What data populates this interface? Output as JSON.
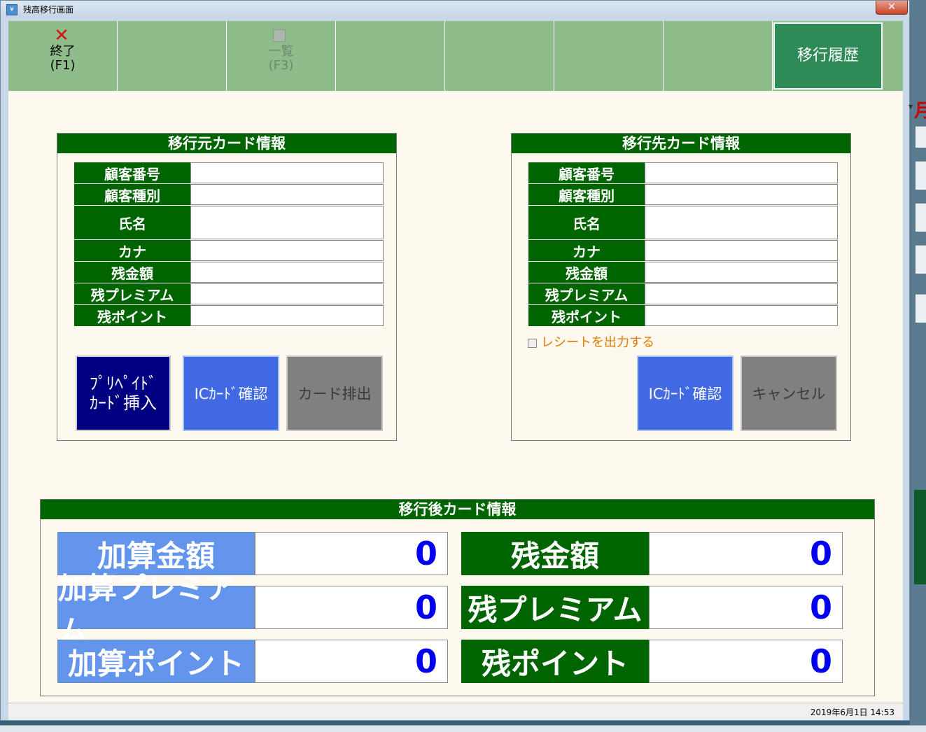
{
  "window": {
    "title": "残高移行画面",
    "close_label": "✕"
  },
  "toolbar": {
    "exit": {
      "label1": "終了",
      "label2": "(F1)"
    },
    "list": {
      "label1": "一覧",
      "label2": "(F3)"
    },
    "history_label": "移行履歴"
  },
  "source_card": {
    "header": "移行元カード情報",
    "fields": [
      {
        "label": "顧客番号",
        "value": ""
      },
      {
        "label": "顧客種別",
        "value": ""
      },
      {
        "label": "氏名",
        "value": ""
      },
      {
        "label": "カナ",
        "value": ""
      },
      {
        "label": "残金額",
        "value": ""
      },
      {
        "label": "残プレミアム",
        "value": ""
      },
      {
        "label": "残ポイント",
        "value": ""
      }
    ],
    "buttons": {
      "insert_line1": "ﾌﾟﾘﾍﾟｲﾄﾞ",
      "insert_line2": "ｶｰﾄﾞ挿入",
      "confirm": "ICｶｰﾄﾞ確認",
      "eject": "カード排出"
    }
  },
  "dest_card": {
    "header": "移行先カード情報",
    "fields": [
      {
        "label": "顧客番号",
        "value": ""
      },
      {
        "label": "顧客種別",
        "value": ""
      },
      {
        "label": "氏名",
        "value": ""
      },
      {
        "label": "カナ",
        "value": ""
      },
      {
        "label": "残金額",
        "value": ""
      },
      {
        "label": "残プレミアム",
        "value": ""
      },
      {
        "label": "残ポイント",
        "value": ""
      }
    ],
    "receipt_label": "レシートを出力する",
    "receipt_checked": false,
    "buttons": {
      "confirm": "ICｶｰﾄﾞ確認",
      "cancel": "キャンセル"
    }
  },
  "after_card": {
    "header": "移行後カード情報",
    "add": [
      {
        "label": "加算金額",
        "value": "0"
      },
      {
        "label": "加算プレミアム",
        "value": "0"
      },
      {
        "label": "加算ポイント",
        "value": "0"
      }
    ],
    "remaining": [
      {
        "label": "残金額",
        "value": "0"
      },
      {
        "label": "残プレミアム",
        "value": "0"
      },
      {
        "label": "残ポイント",
        "value": "0"
      }
    ]
  },
  "status": {
    "datetime": "2019年6月1日 14:53"
  },
  "colors": {
    "header_green": "#006400",
    "toolbar_green": "#8fbc8b",
    "navy": "#000080",
    "blue": "#4169e1",
    "cornflower": "#6495ed",
    "value_blue": "#0000ee"
  }
}
